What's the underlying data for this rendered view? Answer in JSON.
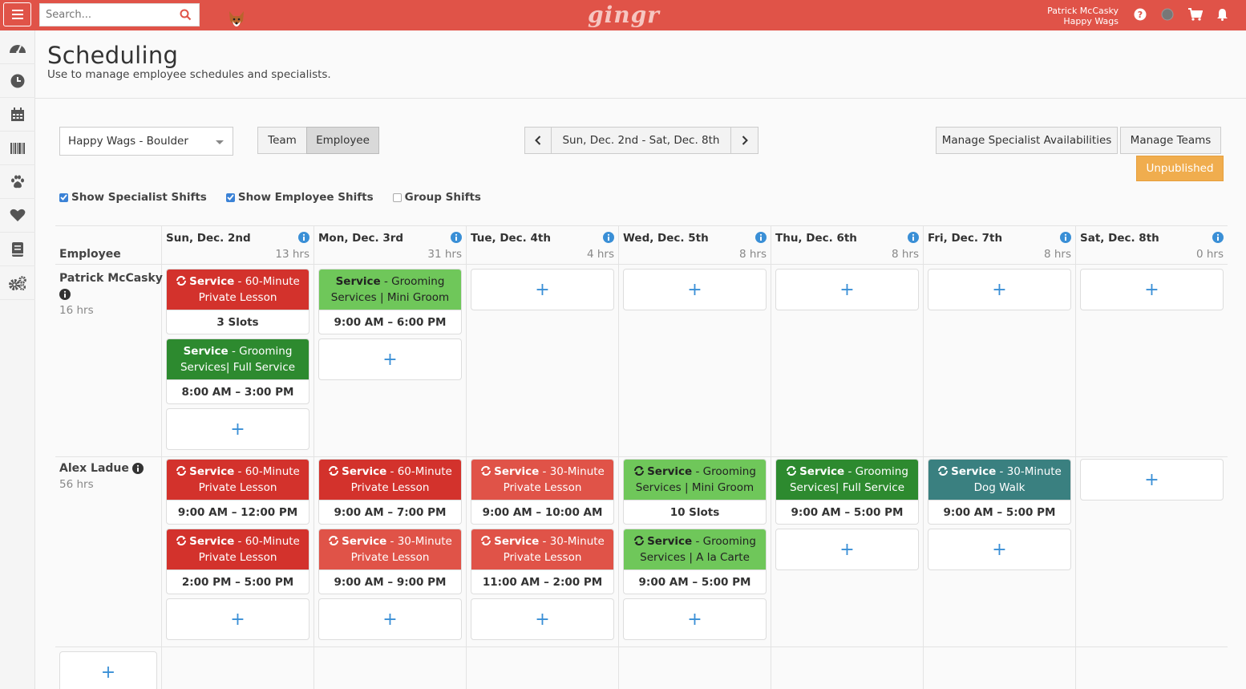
{
  "topbar": {
    "search_placeholder": "Search...",
    "logo": "gingr",
    "user_name": "Patrick McCasky",
    "user_company": "Happy Wags",
    "icons": [
      "hamburger-icon",
      "search-icon",
      "dog-icon",
      "help-icon",
      "status-icon",
      "cart-icon",
      "bell-icon"
    ],
    "accent": "#e05348"
  },
  "sidebar": {
    "icons": [
      "dashboard-icon",
      "clock-icon",
      "calendar-icon",
      "barcode-icon",
      "paw-icon",
      "heart-icon",
      "book-icon",
      "settings-icon"
    ]
  },
  "page": {
    "title": "Scheduling",
    "subtitle": "Use to manage employee schedules and specialists."
  },
  "controls": {
    "location": "Happy Wags - Boulder",
    "view_team": "Team",
    "view_employee": "Employee",
    "date_range": "Sun, Dec. 2nd - Sat, Dec. 8th",
    "manage_specialist": "Manage Specialist Availabilities",
    "manage_teams": "Manage Teams",
    "publish_status": "Unpublished"
  },
  "filters": {
    "show_specialist": "Show Specialist Shifts",
    "show_employee": "Show Employee Shifts",
    "group_shifts": "Group Shifts"
  },
  "grid": {
    "employee_header": "Employee",
    "days": [
      {
        "name": "Sun, Dec. 2nd",
        "hours": "13 hrs"
      },
      {
        "name": "Mon, Dec. 3rd",
        "hours": "31 hrs"
      },
      {
        "name": "Tue, Dec. 4th",
        "hours": "4 hrs"
      },
      {
        "name": "Wed, Dec. 5th",
        "hours": "8 hrs"
      },
      {
        "name": "Thu, Dec. 6th",
        "hours": "8 hrs"
      },
      {
        "name": "Fri, Dec. 7th",
        "hours": "8 hrs"
      },
      {
        "name": "Sat, Dec. 8th",
        "hours": "0 hrs"
      }
    ],
    "employees": [
      {
        "name": "Patrick McCasky",
        "hours": "16 hrs"
      },
      {
        "name": "Alex Ladue",
        "hours": "56 hrs"
      }
    ],
    "service_label": "Service",
    "shifts": {
      "p_sun_1": {
        "desc": " - 60-Minute Private Lesson",
        "bottom": "3 Slots"
      },
      "p_sun_2": {
        "desc": " - Grooming Services| Full Service",
        "bottom": "8:00 AM – 3:00 PM"
      },
      "p_mon_1": {
        "desc": " - Grooming Services | Mini Groom",
        "bottom": "9:00 AM – 6:00 PM"
      },
      "a_sun_1": {
        "desc": " - 60-Minute Private Lesson",
        "bottom": "9:00 AM – 12:00 PM"
      },
      "a_sun_2": {
        "desc": " - 60-Minute Private Lesson",
        "bottom": "2:00 PM – 5:00 PM"
      },
      "a_mon_1": {
        "desc": " - 60-Minute Private Lesson",
        "bottom": "9:00 AM – 7:00 PM"
      },
      "a_mon_2": {
        "desc": " - 30-Minute Private Lesson",
        "bottom": "9:00 AM – 9:00 PM"
      },
      "a_tue_1": {
        "desc": " - 30-Minute Private Lesson",
        "bottom": "9:00 AM – 10:00 AM"
      },
      "a_tue_2": {
        "desc": " - 30-Minute Private Lesson",
        "bottom": "11:00 AM – 2:00 PM"
      },
      "a_wed_1": {
        "desc": " - Grooming Services | Mini Groom",
        "bottom": "10 Slots"
      },
      "a_wed_2": {
        "desc": " - Grooming Services | A la Carte",
        "bottom": "9:00 AM – 5:00 PM"
      },
      "a_thu_1": {
        "desc": " - Grooming Services| Full Service",
        "bottom": "9:00 AM – 5:00 PM"
      },
      "a_fri_1": {
        "desc": " - 30-Minute Dog Walk",
        "bottom": "9:00 AM – 5:00 PM"
      }
    },
    "add_symbol": "+"
  },
  "colors": {
    "private_lesson_60": "#d3322c",
    "private_lesson_30": "#e05348",
    "grooming_light": "#6fc75a",
    "grooming_dark": "#2d8a2f",
    "dog_walk": "#3a8080",
    "unpublished": "#f0ad4e",
    "add": "#3a8fd6"
  }
}
